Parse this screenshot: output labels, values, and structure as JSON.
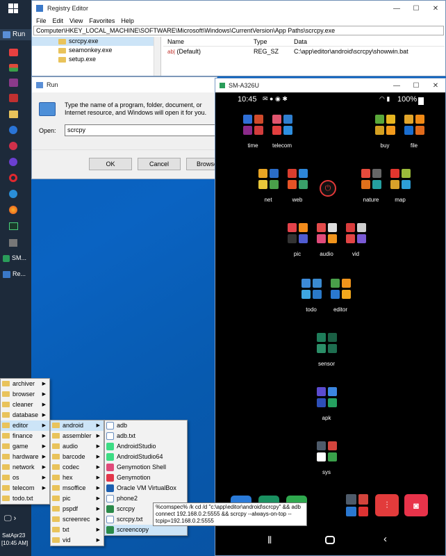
{
  "taskbar": {
    "start_icon": "windows-logo-icon",
    "items": [
      {
        "label": "Run",
        "icon": "run-icon"
      },
      {
        "label": "",
        "icon": "app-red-icon"
      },
      {
        "label": "",
        "icon": "toggle-icon"
      },
      {
        "label": "",
        "icon": "app-purple-icon"
      },
      {
        "label": "",
        "icon": "app-grid-icon"
      },
      {
        "label": "",
        "icon": "folder-icon"
      },
      {
        "label": "",
        "icon": "app-blue-icon"
      },
      {
        "label": "",
        "icon": "app-settings-icon"
      },
      {
        "label": "",
        "icon": "app-purple2-icon"
      },
      {
        "label": "",
        "icon": "opera-icon"
      },
      {
        "label": "",
        "icon": "app-chat-icon"
      },
      {
        "label": "",
        "icon": "firefox-icon"
      },
      {
        "label": "",
        "icon": "terminal-icon"
      },
      {
        "label": "",
        "icon": "grey-app-icon"
      },
      {
        "label": "SM...",
        "icon": "scrcpy-icon"
      },
      {
        "label": "Re...",
        "icon": "regedit-icon"
      }
    ],
    "date": "SatApr23",
    "time": "[10:45 AM]"
  },
  "registry": {
    "title": "Registry Editor",
    "menu": [
      "File",
      "Edit",
      "View",
      "Favorites",
      "Help"
    ],
    "address": "Computer\\HKEY_LOCAL_MACHINE\\SOFTWARE\\Microsoft\\Windows\\CurrentVersion\\App Paths\\scrcpy.exe",
    "tree": [
      "scrcpy.exe",
      "seamonkey.exe",
      "setup.exe"
    ],
    "columns": [
      "Name",
      "Type",
      "Data"
    ],
    "row": {
      "name": "(Default)",
      "type": "REG_SZ",
      "data": "C:\\app\\editor\\android\\scrcpy\\showwin.bat"
    }
  },
  "run": {
    "title": "Run",
    "desc": "Type the name of a program, folder, document, or Internet resource, and Windows will open it for you.",
    "open_label": "Open:",
    "value": "scrcpy",
    "ok": "OK",
    "cancel": "Cancel",
    "browse": "Browse..."
  },
  "phone": {
    "title": "SM-A326U",
    "time": "10:45",
    "battery": "100%",
    "groups": [
      {
        "label": "time",
        "colors": [
          "#2f6fd6",
          "#d04a2b",
          "#8b2a8a",
          "#d23d3d"
        ]
      },
      {
        "label": "telecom",
        "colors": [
          "#e0556e",
          "#2f7fd0",
          "#e23f3f",
          "#2e8fe0"
        ]
      },
      {
        "label": "buy",
        "colors": [
          "#5aa83a",
          "#e6b520",
          "#d4a021",
          "#f29a1c"
        ]
      },
      {
        "label": "file",
        "colors": [
          "#e2a52a",
          "#f08a16",
          "#1a6ed0",
          "#e06a1b"
        ]
      },
      {
        "label": "net",
        "colors": [
          "#e8a524",
          "#2a6cc8",
          "#e8c73a",
          "#4aa04a"
        ]
      },
      {
        "label": "web",
        "colors": [
          "#d93d2e",
          "#2d86d8",
          "#e65326",
          "#3aa06a"
        ]
      },
      {
        "label": "nature",
        "colors": [
          "#e64b3c",
          "#666666",
          "#e0701b",
          "#25a0a0"
        ]
      },
      {
        "label": "map",
        "colors": [
          "#e2362e",
          "#9bbb3a",
          "#d8a12a",
          "#2e9ed6"
        ]
      },
      {
        "label": "pic",
        "colors": [
          "#e3424a",
          "#f28c1c",
          "#333333",
          "#4f5bd0"
        ]
      },
      {
        "label": "audio",
        "colors": [
          "#e24a4a",
          "#dddddd",
          "#e04b7b",
          "#f0941c"
        ]
      },
      {
        "label": "vid",
        "colors": [
          "#d93c3c",
          "#cfcfcf",
          "#e24545",
          "#7a5ad4"
        ]
      },
      {
        "label": "todo",
        "colors": [
          "#3c8ad8",
          "#3a8ad0",
          "#3ea6e0",
          "#2a79c8"
        ]
      },
      {
        "label": "editor",
        "colors": [
          "#4aa04a",
          "#f0941c",
          "#2a78d0",
          "#f2a81d"
        ]
      },
      {
        "label": "sensor",
        "colors": [
          "#1e7d5a",
          "#1a5f44",
          "#2b8e68",
          "#1e6e50"
        ]
      },
      {
        "label": "apk",
        "colors": [
          "#5b4bcf",
          "#3b86e0",
          "#2d4fb8",
          "#25a160"
        ]
      },
      {
        "label": "sys",
        "colors": [
          "#4e5b6a",
          "#d2443c",
          "#ffffff",
          "#3aa04a"
        ]
      }
    ],
    "power_icon": "power-icon",
    "nav": [
      "recents-icon",
      "home-icon",
      "back-icon"
    ]
  },
  "menus": {
    "root": [
      "archiver",
      "browser",
      "cleaner",
      "database",
      "editor",
      "finance",
      "game",
      "hardware",
      "network",
      "os",
      "telecom",
      "todo.txt"
    ],
    "editor": [
      "android",
      "assembler",
      "audio",
      "barcode",
      "codec",
      "hex",
      "msoffice",
      "pic",
      "pspdf",
      "screenrec",
      "txt",
      "vid"
    ],
    "android": [
      "adb",
      "adb.txt",
      "AndroidStudio",
      "AndroidStudio64",
      "Genymotion Shell",
      "Genymotion",
      "Oracle VM VirtualBox",
      "phone2",
      "scrcpy",
      "scrcpy.txt",
      "screencopy"
    ]
  },
  "tooltip": "%comspec% /k cd /d \"c:\\app\\editor\\android\\scrcpy\" && adb connect 192.168.0.2:5555 && scrcpy --always-on-top --tcpip=192.168.0.2:5555"
}
